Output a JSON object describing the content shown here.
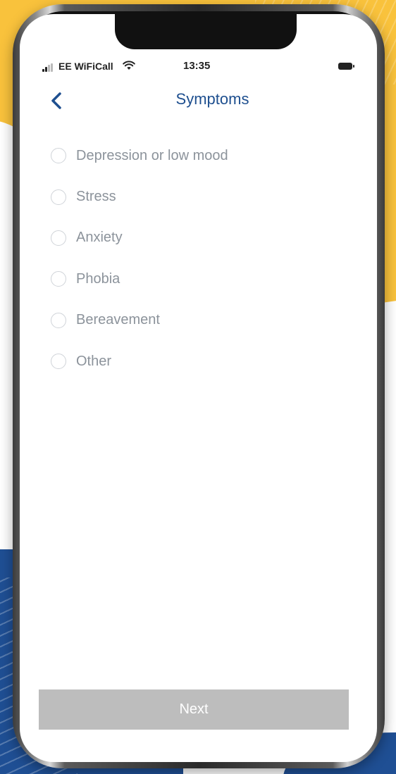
{
  "status_bar": {
    "carrier": "EE WiFiCall",
    "time": "13:35",
    "signal_icon": "signal-bars-icon",
    "wifi_icon": "wifi-icon",
    "battery_icon": "battery-icon"
  },
  "nav": {
    "back_icon": "chevron-left-icon",
    "title": "Symptoms"
  },
  "options": [
    {
      "label": "Depression or low mood",
      "selected": false
    },
    {
      "label": "Stress",
      "selected": false
    },
    {
      "label": "Anxiety",
      "selected": false
    },
    {
      "label": "Phobia",
      "selected": false
    },
    {
      "label": "Bereavement",
      "selected": false
    },
    {
      "label": "Other",
      "selected": false
    }
  ],
  "footer": {
    "next_label": "Next"
  },
  "colors": {
    "title": "#1e4f8f",
    "option_text": "#8c939b",
    "button_disabled": "#bdbdbd",
    "background_yellow": "#f9c23c",
    "background_blue": "#1f4f94"
  }
}
